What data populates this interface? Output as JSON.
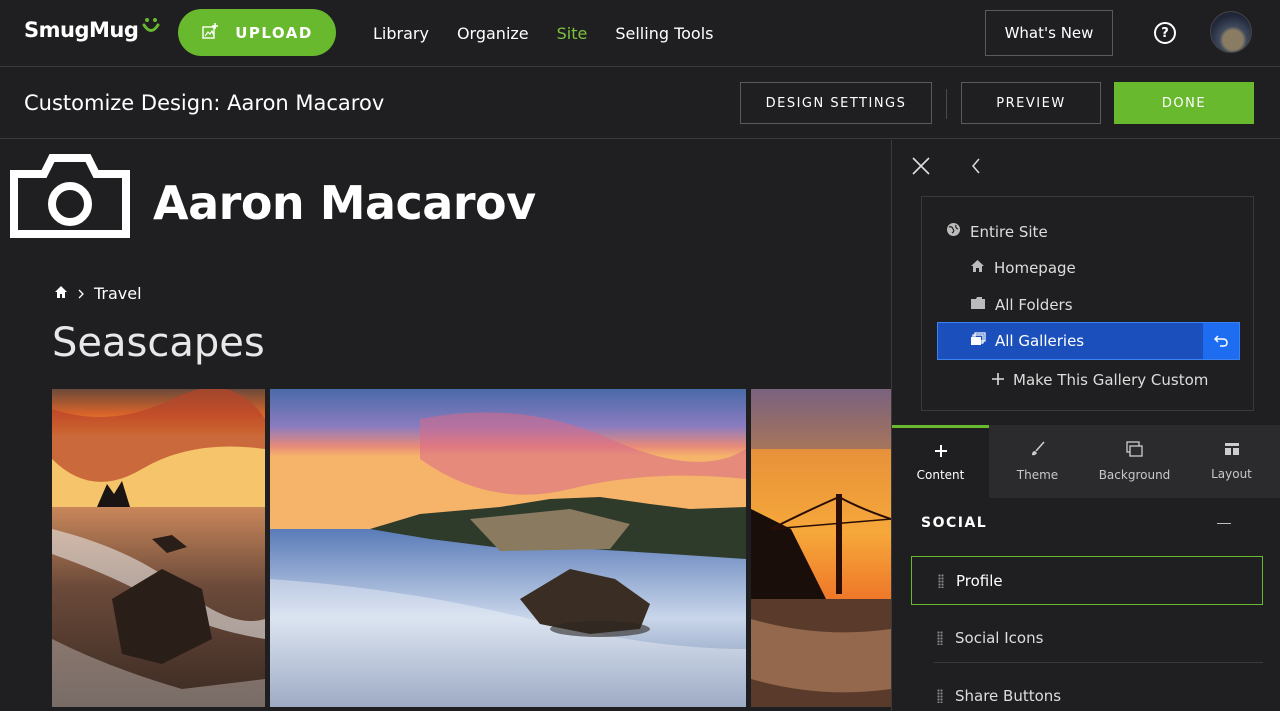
{
  "topbar": {
    "logo_text": "SmugMug",
    "upload_label": "UPLOAD",
    "nav": [
      {
        "label": "Library",
        "active": false
      },
      {
        "label": "Organize",
        "active": false
      },
      {
        "label": "Site",
        "active": true
      },
      {
        "label": "Selling Tools",
        "active": false
      }
    ],
    "whats_new_label": "What's New",
    "help_icon": "?"
  },
  "subbar": {
    "title": "Customize Design: Aaron Macarov",
    "design_settings_label": "DESIGN SETTINGS",
    "preview_label": "PREVIEW",
    "done_label": "DONE"
  },
  "site": {
    "name": "Aaron Macarov",
    "breadcrumb": [
      "Travel"
    ],
    "gallery_title": "Seascapes",
    "photos": [
      "sunset-sea-stack-beach",
      "sunset-log-waves",
      "golden-gate-bridge-sunset"
    ]
  },
  "panel": {
    "tree": {
      "entire_site": "Entire Site",
      "homepage": "Homepage",
      "all_folders": "All Folders",
      "all_galleries": "All Galleries",
      "make_custom": "Make This Gallery Custom"
    },
    "tabs": [
      {
        "label": "Content",
        "icon": "plus-icon",
        "active": true
      },
      {
        "label": "Theme",
        "icon": "brush-icon",
        "active": false
      },
      {
        "label": "Background",
        "icon": "background-icon",
        "active": false
      },
      {
        "label": "Layout",
        "icon": "layout-icon",
        "active": false
      }
    ],
    "section": "SOCIAL",
    "blocks": [
      "Profile",
      "Social Icons",
      "Share Buttons"
    ]
  },
  "colors": {
    "accent_green": "#68b92e",
    "site_active": "#7cc140",
    "selection_blue": "#1b4fbb",
    "background": "#1f1f21"
  }
}
